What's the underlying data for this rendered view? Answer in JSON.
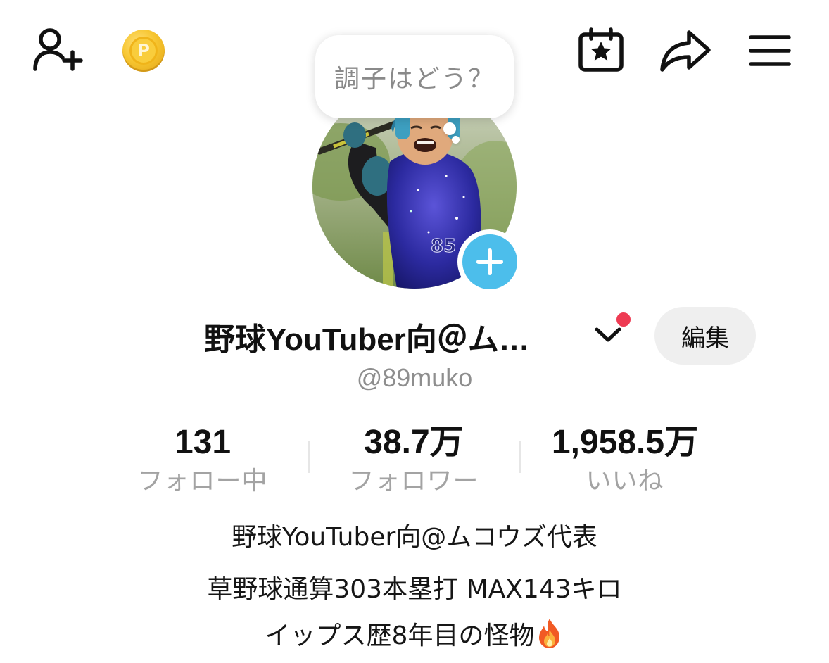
{
  "header": {
    "icons": {
      "add_friend": "person-add-icon",
      "coin": "coin-icon",
      "calendar": "calendar-star-icon",
      "share": "share-arrow-icon",
      "menu": "hamburger-menu-icon"
    },
    "coin_letter": "P"
  },
  "status_bubble": {
    "text": "調子はどう？"
  },
  "profile": {
    "display_name": "野球YouTuber向＠ム…",
    "username": "@89muko",
    "edit_label": "編集",
    "has_notification": true
  },
  "stats": [
    {
      "value": "131",
      "label": "フォロー中"
    },
    {
      "value": "38.7万",
      "label": "フォロワー"
    },
    {
      "value": "1,958.5万",
      "label": "いいね"
    }
  ],
  "bio": {
    "lines": [
      "野球YouTuber向@ムコウズ代表",
      "草野球通算303本塁打 MAX143キロ",
      "イップス歴8年目の怪物"
    ],
    "trailing_emoji": "fire-emoji"
  },
  "colors": {
    "accent_blue": "#4cbeeb",
    "notification_red": "#ee3b53",
    "edit_button_bg": "#efefef",
    "muted_text": "#8e8e8e",
    "coin_gold": "#f7c631"
  }
}
